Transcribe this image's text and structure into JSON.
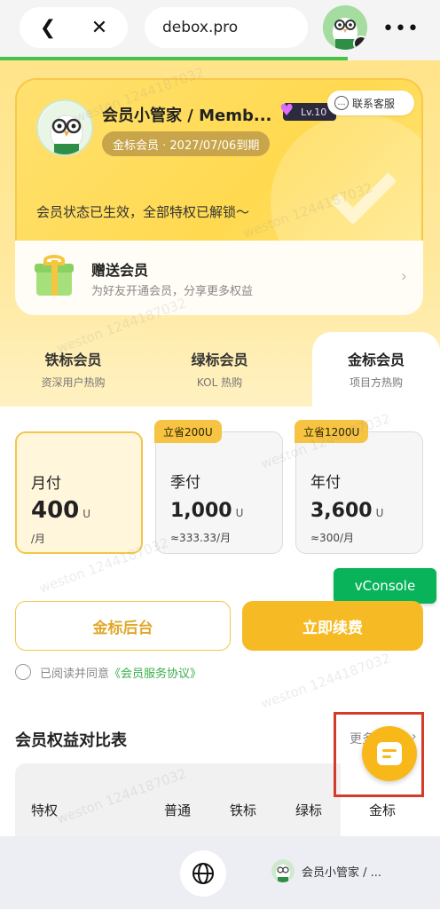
{
  "browser": {
    "back_icon": "back-icon",
    "close_icon": "close-icon",
    "url": "debox.pro",
    "more_icon": "more-icon",
    "progress": 0.79
  },
  "member": {
    "name": "会员小管家 / Memb...",
    "level": "Lv.10",
    "contact": "联系客服",
    "expire": "金标会员 · 2027/07/06到期",
    "status": "会员状态已生效，全部特权已解锁～"
  },
  "gift": {
    "title": "赠送会员",
    "subtitle": "为好友开通会员，分享更多权益"
  },
  "tabs": [
    {
      "title": "铁标会员",
      "sub": "资深用户热购"
    },
    {
      "title": "绿标会员",
      "sub": "KOL 热购"
    },
    {
      "title": "金标会员",
      "sub": "项目方热购"
    }
  ],
  "plans": [
    {
      "period": "月付",
      "price": "400",
      "unit": "U",
      "per": "/月",
      "tag": ""
    },
    {
      "period": "季付",
      "price": "1,000",
      "unit": "U",
      "per": "≈333.33/月",
      "tag": "立省200U"
    },
    {
      "period": "年付",
      "price": "3,600",
      "unit": "U",
      "per": "≈300/月",
      "tag": "立省1200U"
    }
  ],
  "vconsole": "vConsole",
  "actions": {
    "dashboard": "金标后台",
    "renew": "立即续费"
  },
  "agreement": {
    "text": "已阅读并同意",
    "link": "《会员服务协议》"
  },
  "benefits": {
    "title": "会员权益对比表",
    "more": "更多",
    "columns": [
      "特权",
      "普通",
      "铁标",
      "绿标",
      "金标"
    ]
  },
  "bottom": {
    "name": "会员小管家 / ..."
  },
  "watermark": "weston 1244187032",
  "colors": {
    "accent": "#f6bb24",
    "green": "#47c34b",
    "vconsole": "#08b35a"
  }
}
